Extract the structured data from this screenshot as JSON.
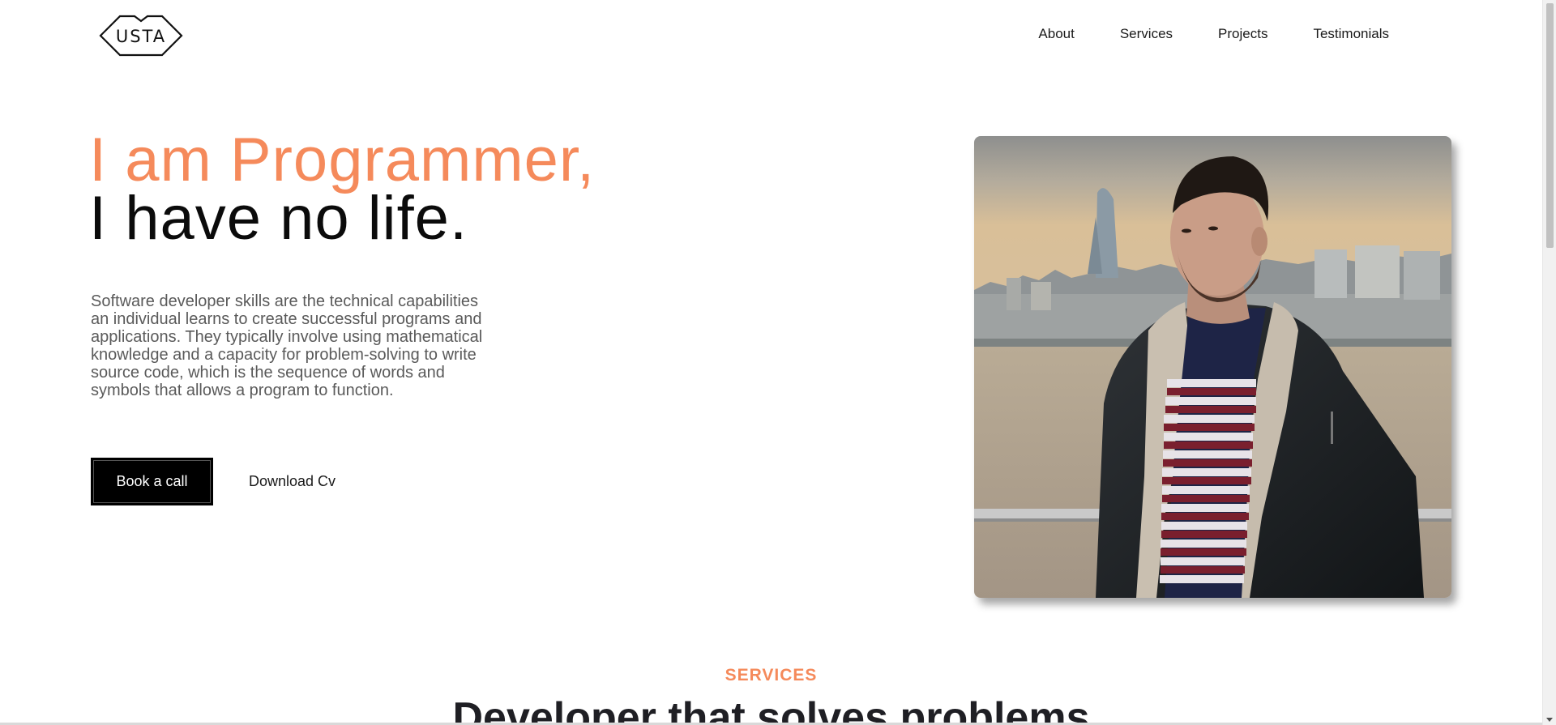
{
  "header": {
    "logo_text": "USTA",
    "nav": [
      {
        "label": "About"
      },
      {
        "label": "Services"
      },
      {
        "label": "Projects"
      },
      {
        "label": "Testimonials"
      }
    ]
  },
  "hero": {
    "title_line1": "I am Programmer,",
    "title_line2": "I have no life.",
    "description": "Software developer skills are the technical capabilities an individual learns to create successful programs and applications. They typically involve using mathematical knowledge and a capacity for problem-solving to write source code, which is the sequence of words and symbols that allows a program to function.",
    "primary_button": "Book a call",
    "secondary_link": "Download Cv",
    "photo_alt": "portrait photo"
  },
  "services": {
    "eyebrow": "SERVICES",
    "heading": "Developer that solves problems"
  },
  "colors": {
    "accent": "#f58a5b",
    "text_dark": "#0b0b0b",
    "text_muted": "#5a5a5a",
    "button_bg": "#000000"
  }
}
